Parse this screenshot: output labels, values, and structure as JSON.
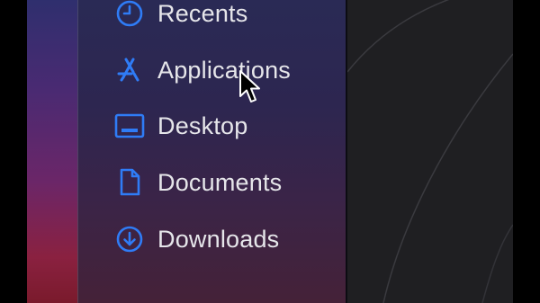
{
  "sidebar": {
    "items": [
      {
        "label": "Recents",
        "icon": "clock-icon"
      },
      {
        "label": "Applications",
        "icon": "applications-icon"
      },
      {
        "label": "Desktop",
        "icon": "desktop-icon"
      },
      {
        "label": "Documents",
        "icon": "document-icon"
      },
      {
        "label": "Downloads",
        "icon": "download-icon"
      }
    ]
  },
  "colors": {
    "accent": "#2f7cf6",
    "label": "#e6e6ea",
    "content_background": "#1f1f22"
  }
}
